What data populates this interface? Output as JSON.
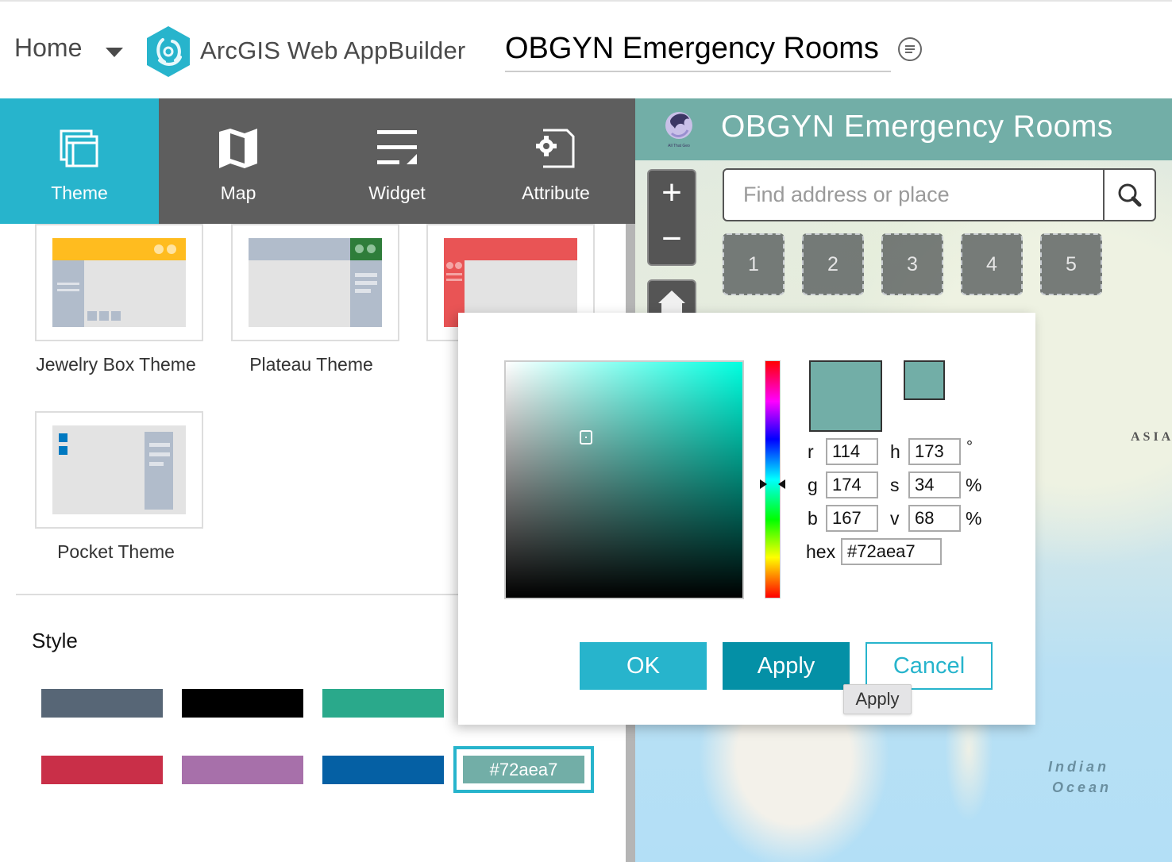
{
  "header": {
    "home_label": "Home",
    "brand_name": "ArcGIS Web AppBuilder",
    "app_title": "OBGYN Emergency Rooms"
  },
  "left_panel": {
    "tabs": [
      {
        "label": "Theme",
        "icon": "theme-icon",
        "active": true
      },
      {
        "label": "Map",
        "icon": "map-icon",
        "active": false
      },
      {
        "label": "Widget",
        "icon": "widget-icon",
        "active": false
      },
      {
        "label": "Attribute",
        "icon": "attribute-icon",
        "active": false
      }
    ],
    "themes": [
      {
        "label": "Jewelry Box Theme",
        "accent": "#ffbc1f"
      },
      {
        "label": "Plateau Theme",
        "accent": "#2e7d3a"
      },
      {
        "label": "",
        "accent": "#e95455"
      },
      {
        "label": "Pocket Theme",
        "accent": "#0079c1"
      }
    ],
    "style_title": "Style",
    "styles": [
      {
        "color": "#576676"
      },
      {
        "color": "#000000"
      },
      {
        "color": "#2aa98b"
      },
      {
        "color": "#c92f48"
      },
      {
        "color": "#a770aa"
      },
      {
        "color": "#0560a4"
      }
    ],
    "custom_style": {
      "label": "#72aea7",
      "color": "#72aea7",
      "selected": true
    }
  },
  "map": {
    "header_title": "OBGYN Emergency Rooms",
    "logo_text": "All That Geo",
    "header_color": "#72aea7",
    "zoom_in_label": "+",
    "zoom_out_label": "−",
    "search_placeholder": "Find address or place",
    "search_value": "",
    "bookmarks": [
      "1",
      "2",
      "3",
      "4",
      "5"
    ],
    "labels": {
      "asia": "ASIA",
      "indian_ocean_line1": "Indian",
      "indian_ocean_line2": "Ocean"
    }
  },
  "color_picker": {
    "selected_color": "#72aea7",
    "previous_color": "#72aea7",
    "hue_max_color": "#00ffe0",
    "fields": {
      "r": {
        "label": "r",
        "value": "114"
      },
      "g": {
        "label": "g",
        "value": "174"
      },
      "b": {
        "label": "b",
        "value": "167"
      },
      "h": {
        "label": "h",
        "value": "173",
        "unit": "°"
      },
      "s": {
        "label": "s",
        "value": "34",
        "unit": "%"
      },
      "v": {
        "label": "v",
        "value": "68",
        "unit": "%"
      },
      "hex": {
        "label": "hex",
        "value": "#72aea7"
      }
    },
    "saturation_pct": 34,
    "value_pct": 68,
    "hue_deg": 173,
    "buttons": {
      "ok": "OK",
      "apply": "Apply",
      "cancel": "Cancel"
    },
    "tooltip": "Apply"
  }
}
